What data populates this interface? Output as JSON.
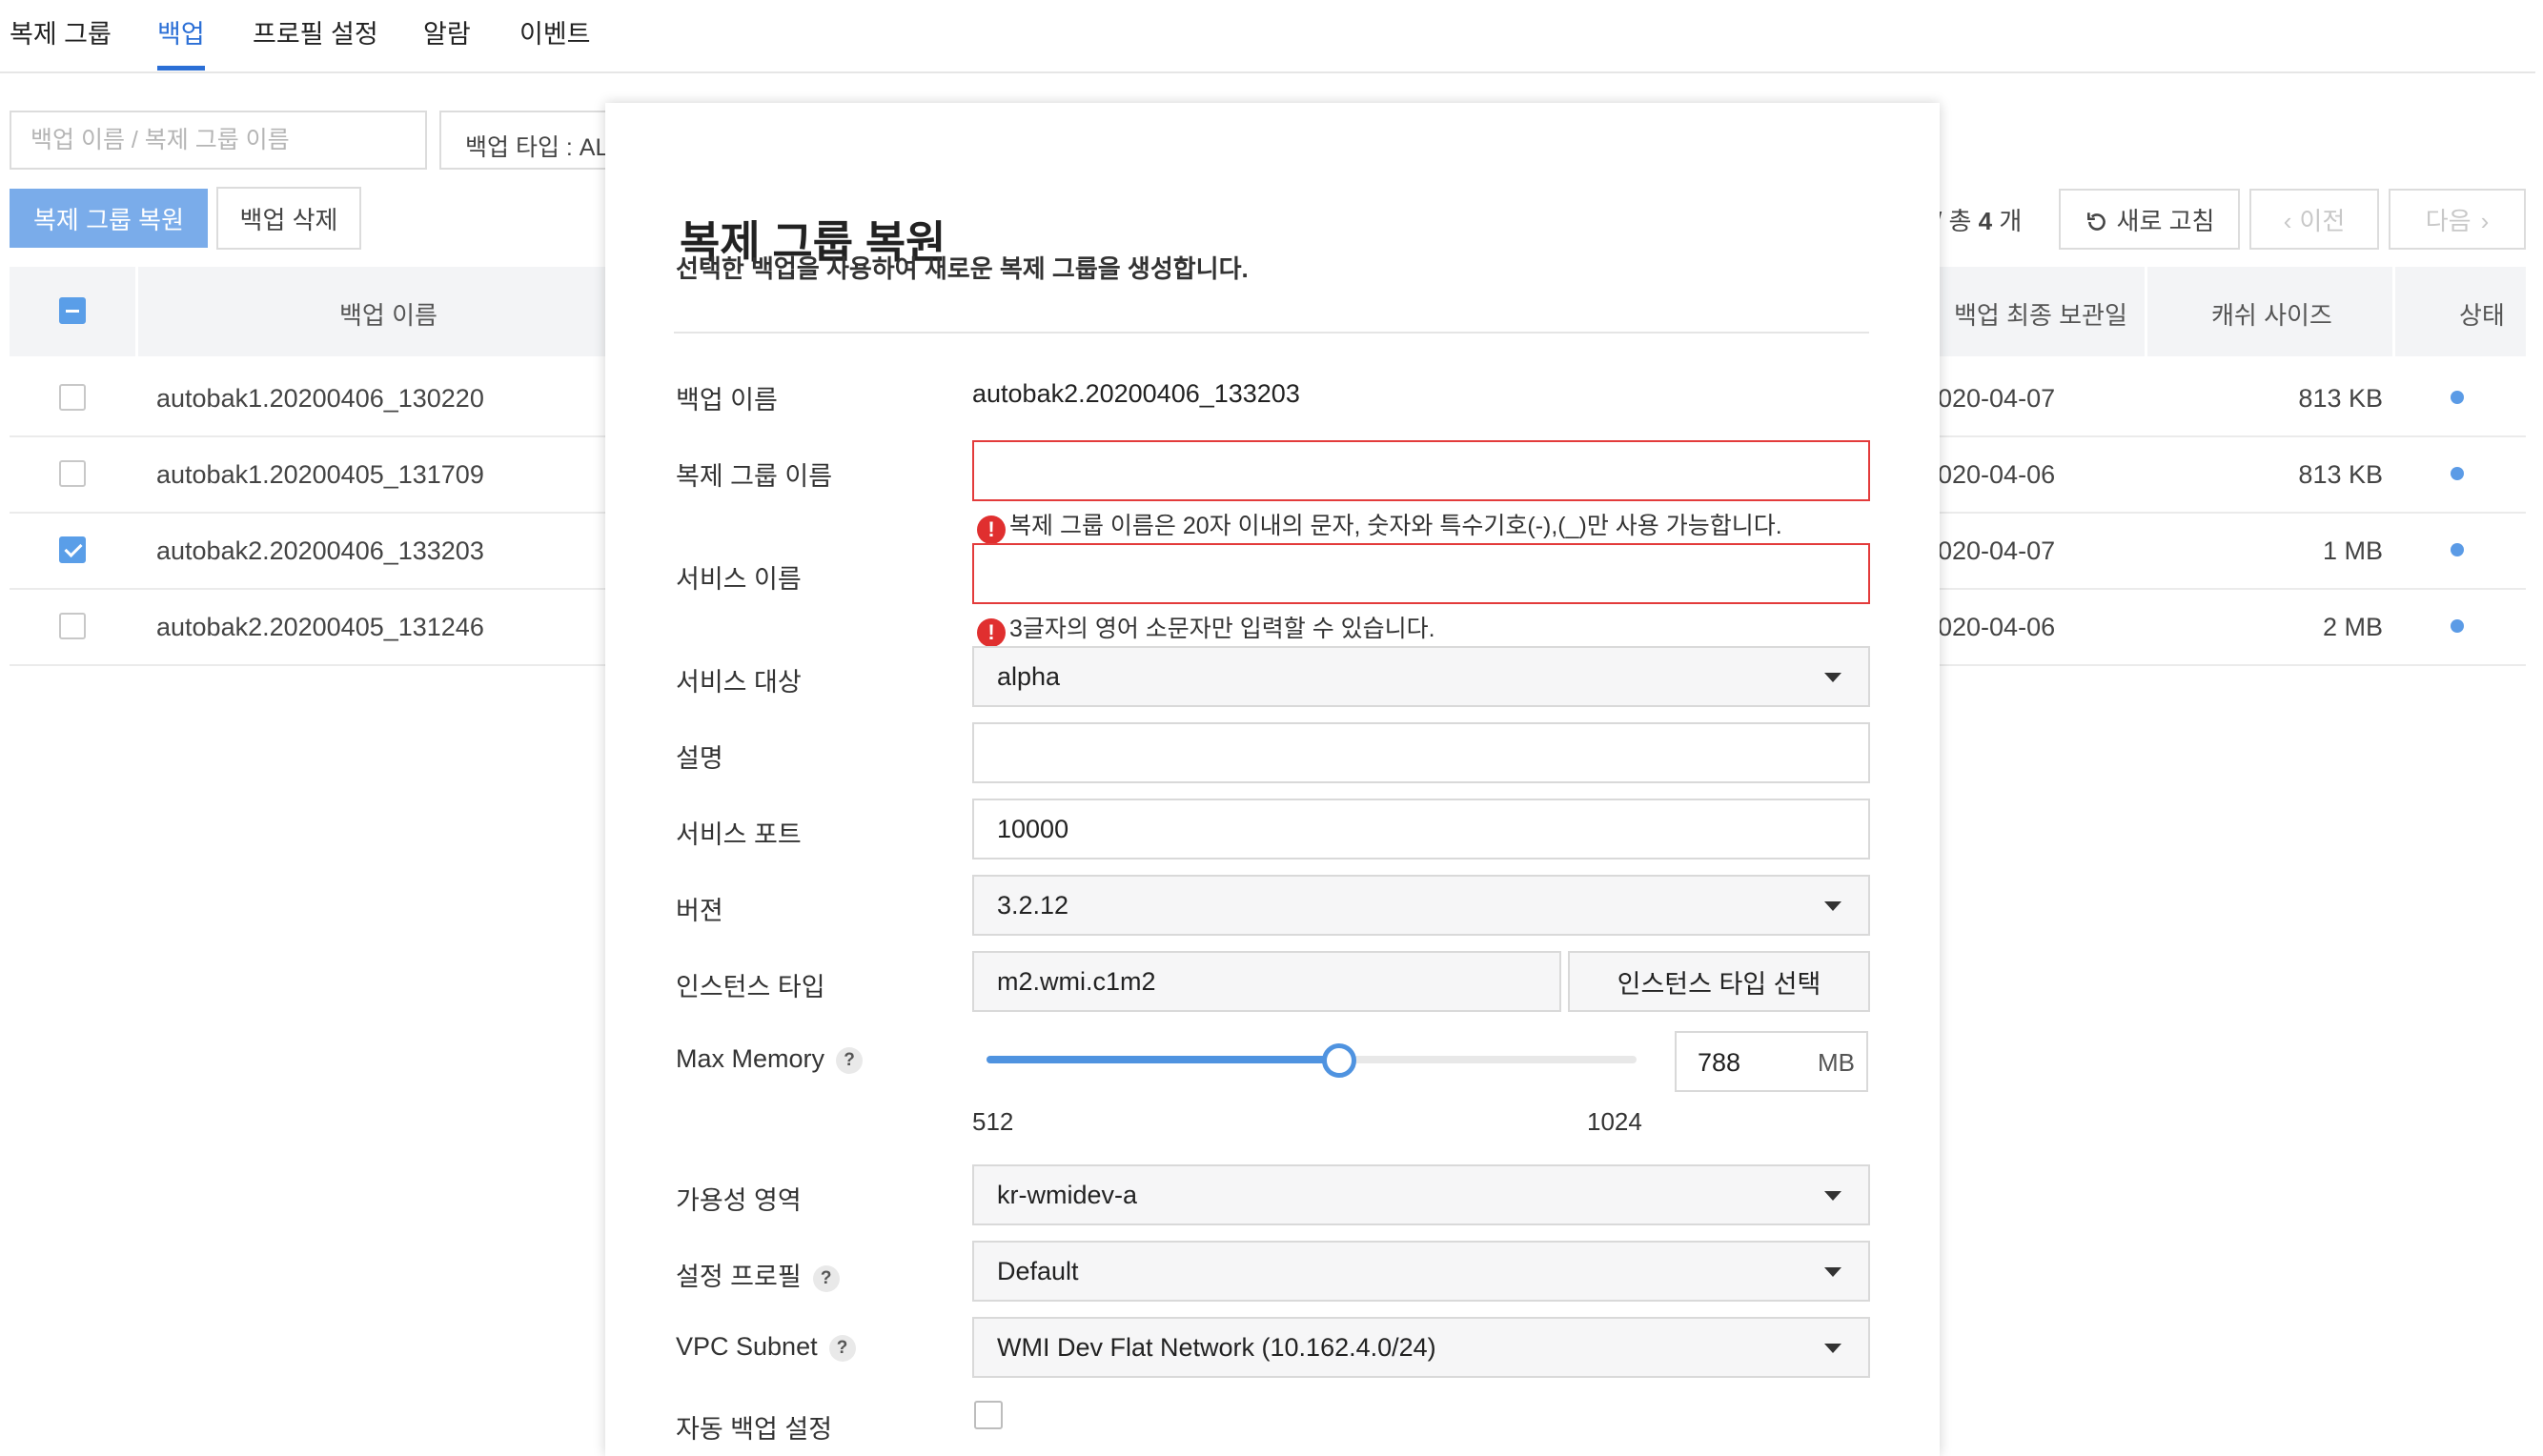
{
  "tabs": [
    "복제 그룹",
    "백업",
    "프로필 설정",
    "알람",
    "이벤트"
  ],
  "active_tab": 1,
  "toolbar": {
    "search_placeholder": "백업 이름 / 복제 그룹 이름",
    "type_filter": "백업 타입 : AL",
    "restore_button": "복제 그룹 복원",
    "delete_button": "백업 삭제",
    "count_prefix": "/ 총",
    "count_value": "4",
    "count_suffix": "개",
    "refresh": "새로 고침",
    "prev": "이전",
    "next": "다음"
  },
  "table": {
    "columns": {
      "name": "백업 이름",
      "retention": "백업 최종 보관일",
      "cache": "캐쉬 사이즈",
      "status": "상태"
    },
    "rows": [
      {
        "name": "autobak1.20200406_130220",
        "retention": "020-04-07",
        "cache": "813 KB",
        "checked": false
      },
      {
        "name": "autobak1.20200405_131709",
        "retention": "020-04-06",
        "cache": "813 KB",
        "checked": false
      },
      {
        "name": "autobak2.20200406_133203",
        "retention": "020-04-07",
        "cache": "1 MB",
        "checked": true
      },
      {
        "name": "autobak2.20200405_131246",
        "retention": "020-04-06",
        "cache": "2 MB",
        "checked": false
      }
    ],
    "status_color": "#5b9be6"
  },
  "modal": {
    "title": "복제 그룹 복원",
    "description": "선택한 백업을 사용하여 새로운 복제 그룹을 생성합니다.",
    "labels": {
      "backup_name": "백업 이름",
      "group_name": "복제 그룹 이름",
      "service_name": "서비스 이름",
      "service_target": "서비스 대상",
      "description": "설명",
      "service_port": "서비스 포트",
      "version": "버젼",
      "instance_type": "인스턴스 타입",
      "max_memory": "Max Memory",
      "availability_zone": "가용성 영역",
      "config_profile": "설정 프로필",
      "vpc_subnet": "VPC Subnet",
      "auto_backup": "자동 백업 설정"
    },
    "backup_name_value": "autobak2.20200406_133203",
    "group_name_error": "복제 그룹 이름은 20자 이내의 문자, 숫자와 특수기호(-),(_)만 사용 가능합니다.",
    "service_name_error": "3글자의 영어 소문자만 입력할 수 있습니다.",
    "service_target_value": "alpha",
    "service_port_value": "10000",
    "version_value": "3.2.12",
    "instance_type_value": "m2.wmi.c1m2",
    "instance_type_button": "인스턴스 타입 선택",
    "memory": {
      "value": "788",
      "unit": "MB",
      "min": "512",
      "max": "1024",
      "fraction": 0.54
    },
    "availability_zone_value": "kr-wmidev-a",
    "config_profile_value": "Default",
    "vpc_subnet_value": "WMI Dev Flat Network (10.162.4.0/24)",
    "auto_backup_checked": false,
    "accent_color": "#4f93e0",
    "error_color": "#e33b3b"
  }
}
